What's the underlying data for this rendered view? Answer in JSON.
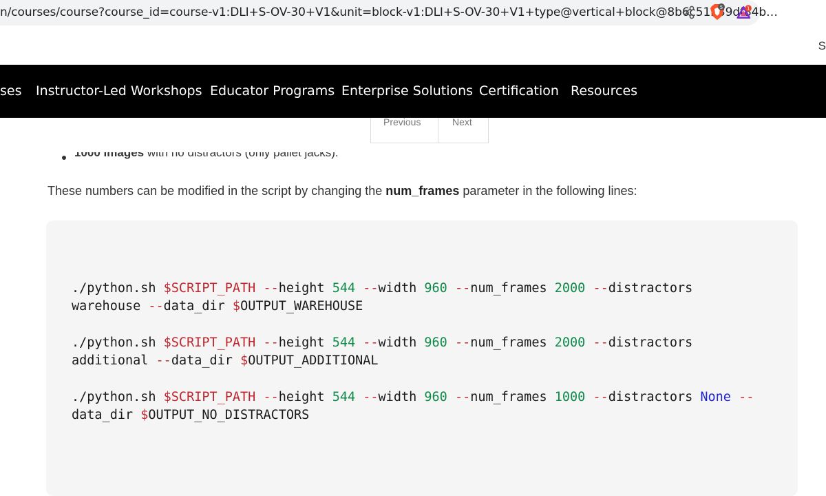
{
  "browser": {
    "url": "n/courses/course?course_id=course-v1:DLI+S-OV-30+V1&unit=block-v1:DLI+S-OV-30+V1+type@vertical+block@8b6c51b39df84b…",
    "brave_badge": "5",
    "rewards_badge": "1",
    "icons": [
      "share-icon",
      "brave-shields-icon",
      "brave-rewards-icon"
    ]
  },
  "header": {
    "corner_text": "S"
  },
  "nav": {
    "items": [
      {
        "label": "ses"
      },
      {
        "label": "Instructor-Led Workshops"
      },
      {
        "label": "Educator Programs"
      },
      {
        "label": "Enterprise Solutions"
      },
      {
        "label": "Certification"
      },
      {
        "label": "Resources"
      }
    ]
  },
  "pager": {
    "previous": "Previous",
    "next": "Next"
  },
  "content": {
    "bullet_bold": "1000 images",
    "bullet_rest": " with no distractors (only pallet jacks).",
    "paragraph_before": "These numbers can be modified in the script by changing the ",
    "paragraph_bold": "num_frames",
    "paragraph_after": " parameter in the following lines:"
  },
  "code": {
    "lines": [
      {
        "cmd": "./python.sh ",
        "var": "$SCRIPT_PATH",
        "f1": "--",
        "p1": "height ",
        "n1": "544",
        "f2": "--",
        "p2": "width ",
        "n2": "960",
        "f3": "--",
        "p3": "num_frames ",
        "n3": "2000",
        "f4": "--",
        "p4": "distractors"
      },
      {
        "arg": "warehouse ",
        "f5": "--",
        "p5": "data_dir ",
        "var2": "$",
        "rest": "OUTPUT_WAREHOUSE"
      },
      {
        "cmd": "./python.sh ",
        "var": "$SCRIPT_PATH",
        "f1": "--",
        "p1": "height ",
        "n1": "544",
        "f2": "--",
        "p2": "width ",
        "n2": "960",
        "f3": "--",
        "p3": "num_frames ",
        "n3": "2000",
        "f4": "--",
        "p4": "distractors"
      },
      {
        "arg": "additional ",
        "f5": "--",
        "p5": "data_dir ",
        "var2": "$",
        "rest": "OUTPUT_ADDITIONAL"
      },
      {
        "cmd": "./python.sh ",
        "var": "$SCRIPT_PATH",
        "f1": "--",
        "p1": "height ",
        "n1": "544",
        "f2": "--",
        "p2": "width ",
        "n2": "960",
        "f3": "--",
        "p3": "num_frames ",
        "n3": "1000",
        "f4": "--",
        "p4": "distractors ",
        "kw": "None",
        "f6": " --"
      },
      {
        "arg": "data_dir ",
        "var2": "$",
        "rest": "OUTPUT_NO_DISTRACTORS"
      }
    ]
  }
}
